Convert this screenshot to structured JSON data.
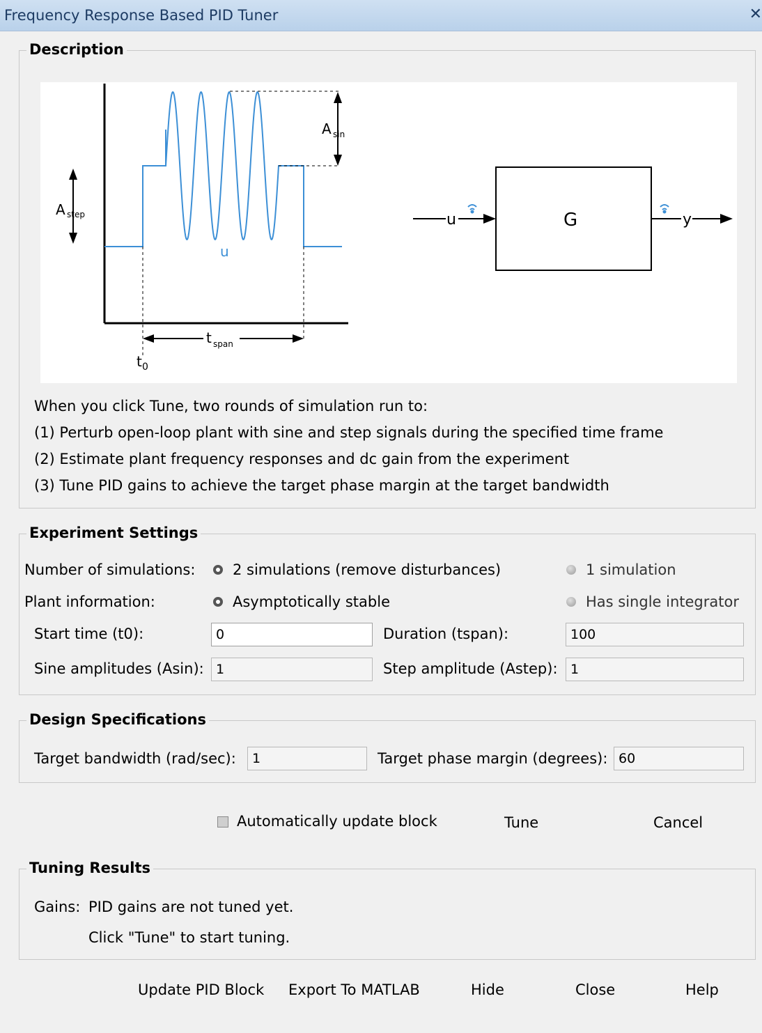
{
  "window": {
    "title": "Frequency Response Based PID Tuner",
    "close_glyph": "✕"
  },
  "description": {
    "legend": "Description",
    "diagram": {
      "amp_step_label": "A",
      "amp_step_sub": "step",
      "amp_sin_label": "A",
      "amp_sin_sub": "sin",
      "signal_label": "u",
      "time_start": "t",
      "time_start_sub": "0",
      "time_span": "t",
      "time_span_sub": "span",
      "block_name": "G",
      "input_label": "u",
      "output_label": "y",
      "signal_color": "#3c8fd6"
    },
    "lines": [
      "When you click Tune, two rounds of simulation run to:",
      "(1) Perturb open-loop plant with sine and step signals during the specified time frame",
      "(2) Estimate plant frequency responses and dc gain from the experiment",
      "(3) Tune PID gains to achieve the target phase margin at the target bandwidth"
    ]
  },
  "experiment": {
    "legend": "Experiment Settings",
    "num_sims_label": "Number of simulations:",
    "num_sims_opt1": "2 simulations (remove disturbances)",
    "num_sims_opt2": "1 simulation",
    "plant_label": "Plant information:",
    "plant_opt1": "Asymptotically stable",
    "plant_opt2": "Has single integrator",
    "start_time_label": "Start time (t0):",
    "start_time_value": "0",
    "duration_label": "Duration (tspan):",
    "duration_value": "100",
    "sine_amp_label": "Sine amplitudes (Asin):",
    "sine_amp_value": "1",
    "step_amp_label": "Step amplitude (Astep):",
    "step_amp_value": "1"
  },
  "design": {
    "legend": "Design Specifications",
    "bandwidth_label": "Target bandwidth (rad/sec):",
    "bandwidth_value": "1",
    "phase_label": "Target phase margin (degrees):",
    "phase_value": "60"
  },
  "actions": {
    "auto_update_label": "Automatically update block",
    "tune": "Tune",
    "cancel": "Cancel"
  },
  "results": {
    "legend": "Tuning Results",
    "gains_label": "Gains:",
    "gains_line1": "PID gains are not tuned yet.",
    "gains_line2": "Click \"Tune\" to start tuning."
  },
  "footer": {
    "update": "Update PID Block",
    "export": "Export To MATLAB",
    "hide": "Hide",
    "close": "Close",
    "help": "Help"
  }
}
